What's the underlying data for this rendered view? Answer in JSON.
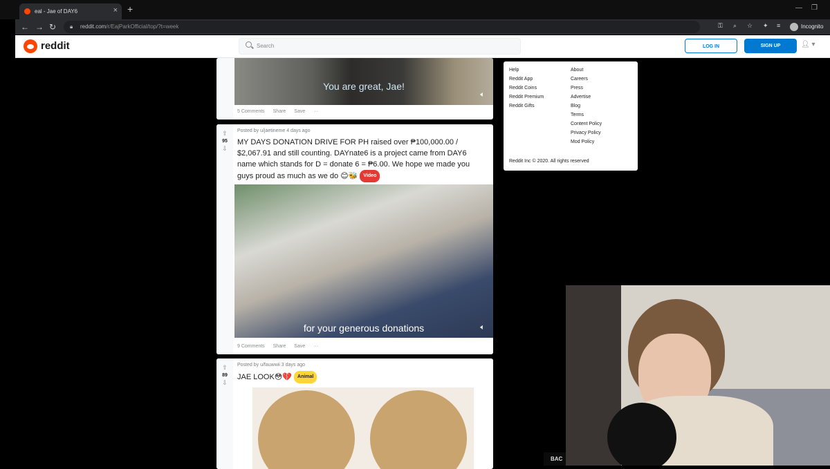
{
  "browser": {
    "tab_title": "eal - Jae of DAY6",
    "url_host": "reddit.com",
    "url_path": "/r/EajParkOfficial/top/?t=week",
    "profile": "Incognito"
  },
  "header": {
    "brand": "reddit",
    "search_placeholder": "Search",
    "login": "LOG IN",
    "signup": "SIGN UP"
  },
  "posts": [
    {
      "caption": "You are great, Jae!",
      "comments": "5 Comments",
      "share": "Share",
      "save": "Save",
      "more": "···"
    },
    {
      "score": "95",
      "meta": "Posted by u/jaetineme 4 days ago",
      "title": "MY DAYS DONATION DRIVE FOR PH raised over ₱100,000.00 / $2,067.91 and still counting. DAYnate6 is a project came from DAY6 name which stands for D = donate 6 = ₱6.00. We hope we made you guys proud as much as we do 😊🐝",
      "flair": "Video",
      "caption": "for your generous donations",
      "comments": "9 Comments",
      "share": "Share",
      "save": "Save",
      "more": "···"
    },
    {
      "score": "89",
      "meta": "Posted by u/fauwwii 3 days ago",
      "title": "JAE LOOK😳💔",
      "flair": "Animal"
    }
  ],
  "sidebar": {
    "col1": [
      "Help",
      "Reddit App",
      "Reddit Coins",
      "Reddit Premium",
      "Reddit Gifts"
    ],
    "col2": [
      "About",
      "Careers",
      "Press",
      "Advertise",
      "Blog",
      "Terms",
      "Content Policy",
      "Privacy Policy",
      "Mod Policy"
    ],
    "copyright": "Reddit Inc © 2020. All rights reserved"
  },
  "back_button": "BAC",
  "colors": {
    "reddit_orange": "#ff4500",
    "reddit_blue": "#0079d3",
    "video_flair": "#e53935",
    "animal_flair": "#ffd635"
  }
}
